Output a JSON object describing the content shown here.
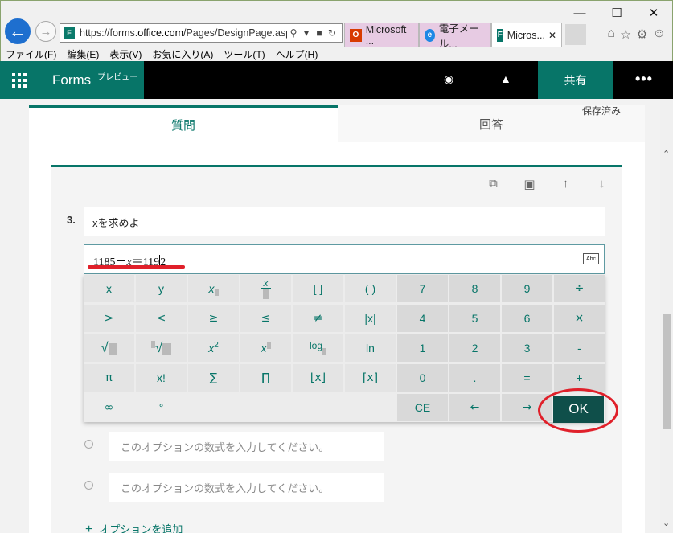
{
  "browser": {
    "url_prefix": "https://forms.",
    "url_domain": "office.com",
    "url_path": "/Pages/DesignPage.aspx",
    "tabs": [
      {
        "label": "Microsoft ..."
      },
      {
        "label": "電子メール..."
      },
      {
        "label": "Micros..."
      }
    ],
    "menu": [
      "ファイル(F)",
      "編集(E)",
      "表示(V)",
      "お気に入り(A)",
      "ツール(T)",
      "ヘルプ(H)"
    ]
  },
  "appbar": {
    "app_name": "Forms",
    "badge": "プレビュー",
    "share_label": "共有",
    "more_label": "•••"
  },
  "design": {
    "tab_questions": "質問",
    "tab_responses": "回答",
    "saved_status": "保存済み",
    "question_number": "3.",
    "question_title": "xを求めよ",
    "math_expr_a": "1185＋",
    "math_expr_var": "x",
    "math_expr_b": "＝119",
    "math_expr_c": "2",
    "abc_label": "Abc",
    "option_placeholder_1": "このオプションの数式を入力してください。",
    "option_placeholder_2": "このオプションの数式を入力してください。",
    "add_option": "オプションを追加"
  },
  "keypad": {
    "row1": [
      "x",
      "y",
      "[ ]",
      "( )",
      "7",
      "8",
      "9",
      "÷"
    ],
    "row2": [
      ">",
      "<",
      "≥",
      "≤",
      "≠",
      "|x|",
      "4",
      "5",
      "6",
      "×"
    ],
    "row3": [
      "log",
      "ln",
      "1",
      "2",
      "3",
      "-"
    ],
    "row4": [
      "π",
      "x!",
      "∑",
      "∏",
      "⌊x⌋",
      "⌈x⌉",
      "0",
      ".",
      "=",
      "+"
    ],
    "row5": [
      "∞",
      "°",
      "CE",
      "←",
      "→"
    ],
    "ok_label": "OK"
  },
  "colors": {
    "accent": "#077568",
    "annotation": "#e0202a"
  }
}
